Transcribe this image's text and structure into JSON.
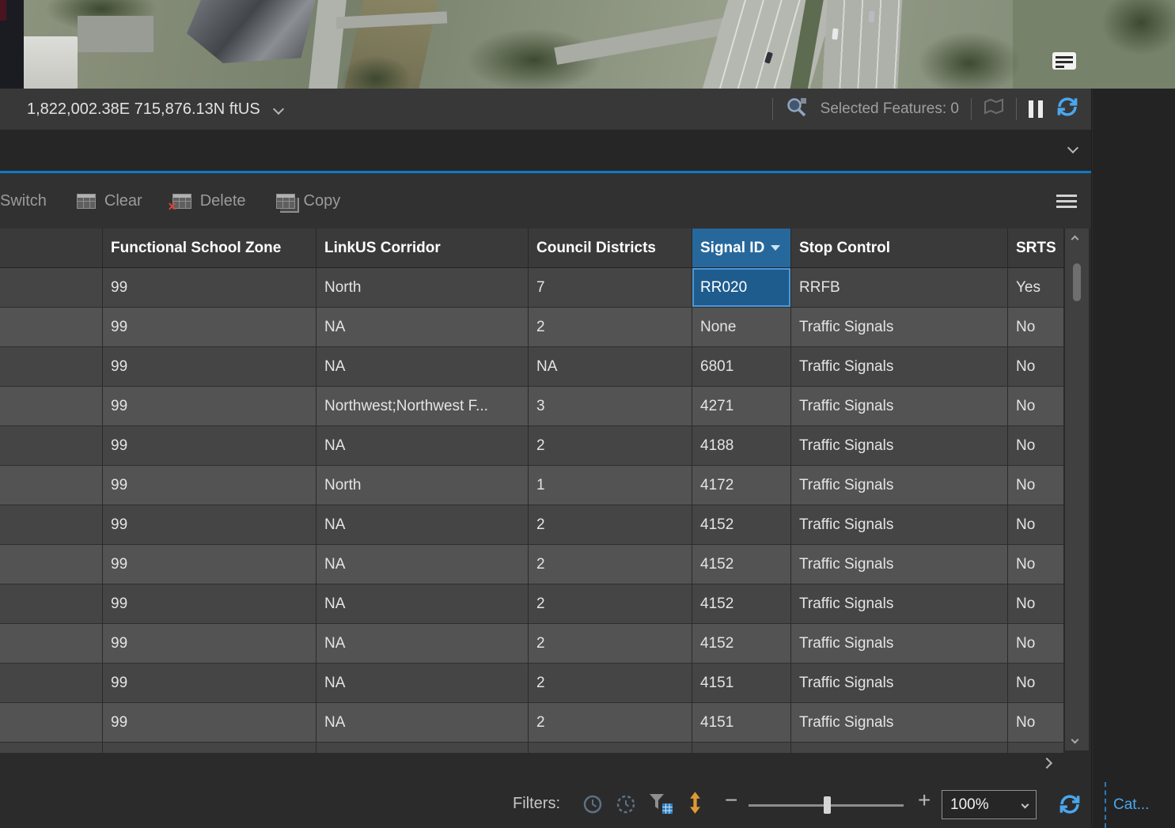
{
  "statusbar": {
    "coordinates": "1,822,002.38E 715,876.13N ftUS",
    "selected_features": "Selected Features: 0"
  },
  "toolbar": {
    "switch": "Switch",
    "clear": "Clear",
    "delete": "Delete",
    "copy": "Copy"
  },
  "table": {
    "columns": [
      "",
      "Functional School Zone",
      "LinkUS Corridor",
      "Council Districts",
      "Signal ID",
      "Stop Control",
      "SRTS"
    ],
    "sort": {
      "column": "Signal ID",
      "direction": "descending"
    },
    "rows": [
      [
        "99",
        "North",
        "7",
        "RR020",
        "RRFB",
        "Yes"
      ],
      [
        "99",
        "NA",
        "2",
        "None",
        "Traffic Signals",
        "No"
      ],
      [
        "99",
        "NA",
        "NA",
        "6801",
        "Traffic Signals",
        "No"
      ],
      [
        "99",
        "Northwest;Northwest F...",
        "3",
        "4271",
        "Traffic Signals",
        "No"
      ],
      [
        "99",
        "NA",
        "2",
        "4188",
        "Traffic Signals",
        "No"
      ],
      [
        "99",
        "North",
        "1",
        "4172",
        "Traffic Signals",
        "No"
      ],
      [
        "99",
        "NA",
        "2",
        "4152",
        "Traffic Signals",
        "No"
      ],
      [
        "99",
        "NA",
        "2",
        "4152",
        "Traffic Signals",
        "No"
      ],
      [
        "99",
        "NA",
        "2",
        "4152",
        "Traffic Signals",
        "No"
      ],
      [
        "99",
        "NA",
        "2",
        "4152",
        "Traffic Signals",
        "No"
      ],
      [
        "99",
        "NA",
        "2",
        "4151",
        "Traffic Signals",
        "No"
      ],
      [
        "99",
        "NA",
        "2",
        "4151",
        "Traffic Signals",
        "No"
      ]
    ],
    "selected_cell": {
      "row": 0,
      "col": 3,
      "value": "RR020"
    }
  },
  "bottombar": {
    "filters_label": "Filters:",
    "zoom_value": "100%"
  },
  "catalog_tab": "Cat...",
  "colors": {
    "accent_blue": "#0d7ac6",
    "refresh_blue": "#4aa7ee",
    "sorted_header_bg": "#27689c",
    "selected_cell_bg": "#1e5c8e",
    "catalog_tab_blue": "#4aa7ee",
    "delete_x_red": "#d6473c"
  }
}
